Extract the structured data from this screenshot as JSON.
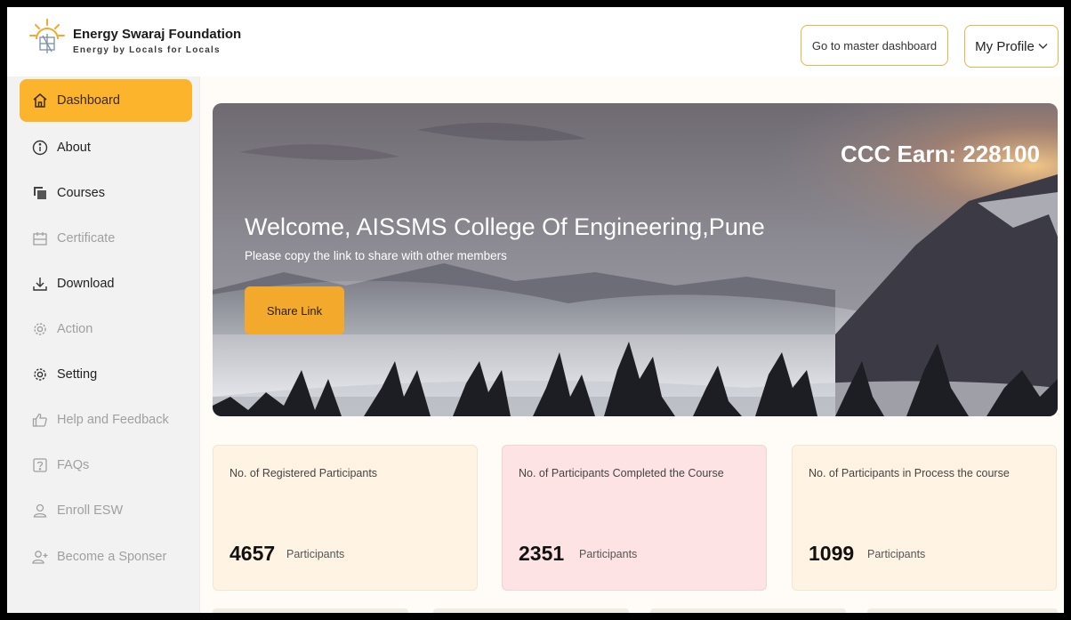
{
  "header": {
    "brand_name": "Energy Swaraj Foundation",
    "brand_tagline": "Energy by Locals for Locals",
    "master_dashboard_label": "Go to master dashboard",
    "profile_label": "My Profile"
  },
  "sidebar": {
    "items": [
      {
        "label": "Dashboard",
        "icon": "home-icon",
        "state": "active"
      },
      {
        "label": "About",
        "icon": "info-icon",
        "state": "normal"
      },
      {
        "label": "Courses",
        "icon": "courses-icon",
        "state": "normal"
      },
      {
        "label": "Certificate",
        "icon": "certificate-icon",
        "state": "disabled"
      },
      {
        "label": "Download",
        "icon": "download-icon",
        "state": "normal"
      },
      {
        "label": "Action",
        "icon": "gear-icon",
        "state": "disabled"
      },
      {
        "label": "Setting",
        "icon": "gear-icon",
        "state": "normal"
      },
      {
        "label": "Help and Feedback",
        "icon": "thumbs-up-icon",
        "state": "disabled"
      },
      {
        "label": "FAQs",
        "icon": "question-icon",
        "state": "disabled"
      },
      {
        "label": "Enroll ESW",
        "icon": "user-icon",
        "state": "disabled"
      },
      {
        "label": "Become a Sponser",
        "icon": "add-user-icon",
        "state": "disabled"
      }
    ]
  },
  "hero": {
    "ccc_earn": "CCC Earn: 228100",
    "welcome": "Welcome, AISSMS College Of Engineering,Pune",
    "subtitle": "Please copy the link to share with other members",
    "share_label": "Share Link"
  },
  "stats": [
    {
      "title": "No. of Registered Participants",
      "value": "4657",
      "unit": "Participants",
      "bg": "#fff4e3"
    },
    {
      "title": "No. of Participants Completed the Course",
      "value": "2351",
      "unit": "Participants",
      "bg": "#fde3e4"
    },
    {
      "title": "No. of Participants in Process the course",
      "value": "1099",
      "unit": "Participants",
      "bg": "#fff4e3"
    }
  ],
  "colors": {
    "accent": "#fbb42c",
    "button": "#f3aa2c",
    "disabled_text": "#a0a0a0"
  }
}
